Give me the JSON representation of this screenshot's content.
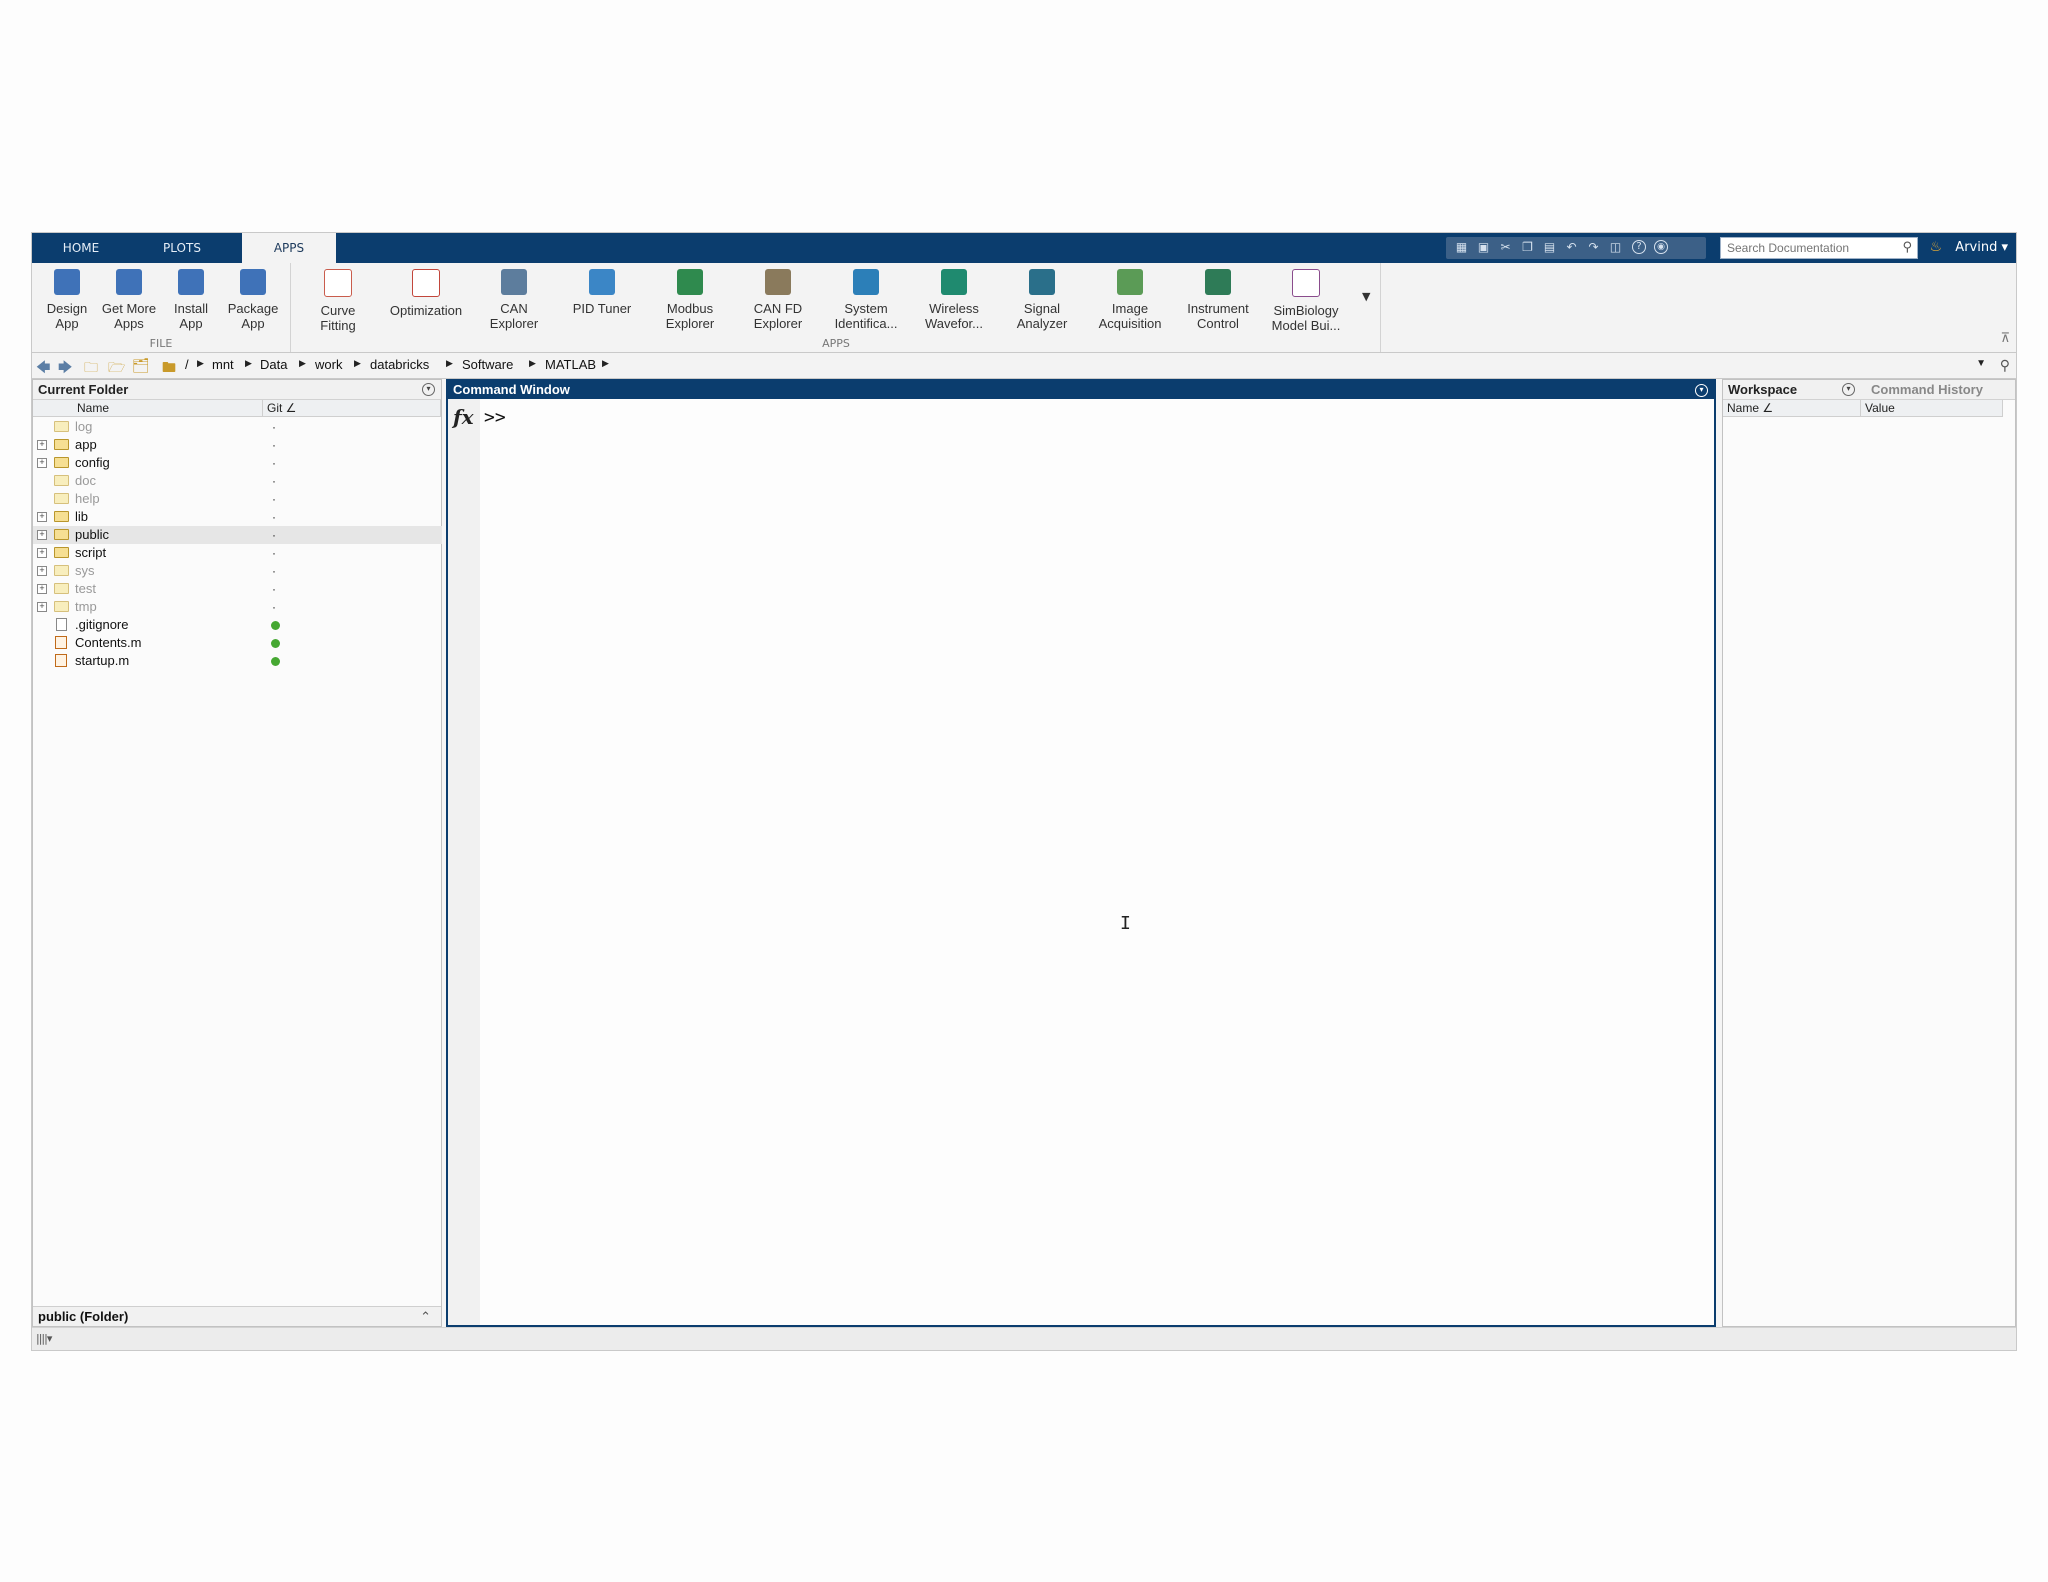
{
  "tabs": [
    {
      "label": "HOME",
      "active": false
    },
    {
      "label": "PLOTS",
      "active": false
    },
    {
      "label": "APPS",
      "active": true
    }
  ],
  "search": {
    "placeholder": "Search Documentation"
  },
  "user": {
    "name": "Arvind ▾"
  },
  "ribbon": {
    "file_section": {
      "label": "FILE",
      "buttons": [
        {
          "line1": "Design",
          "line2": "App",
          "icon": "design-app-icon",
          "color": "#3f72b8"
        },
        {
          "line1": "Get More",
          "line2": "Apps",
          "icon": "get-more-apps-icon",
          "color": "#3f72b8"
        },
        {
          "line1": "Install",
          "line2": "App",
          "icon": "install-app-icon",
          "color": "#3f72b8"
        },
        {
          "line1": "Package",
          "line2": "App",
          "icon": "package-app-icon",
          "color": "#3f72b8"
        }
      ]
    },
    "apps_section": {
      "label": "APPS",
      "buttons": [
        {
          "line1": "Curve",
          "line2": "Fitting",
          "icon": "curve-fitting-icon",
          "color": "#c95c4c"
        },
        {
          "line1": "Optimization",
          "line2": "",
          "icon": "optimization-icon",
          "color": "#c2463b"
        },
        {
          "line1": "CAN",
          "line2": "Explorer",
          "icon": "can-explorer-icon",
          "color": "#5d7d9d"
        },
        {
          "line1": "PID Tuner",
          "line2": "",
          "icon": "pid-tuner-icon",
          "color": "#3b86c6"
        },
        {
          "line1": "Modbus",
          "line2": "Explorer",
          "icon": "modbus-explorer-icon",
          "color": "#2f8a4e"
        },
        {
          "line1": "CAN FD",
          "line2": "Explorer",
          "icon": "can-fd-explorer-icon",
          "color": "#8a7a5c"
        },
        {
          "line1": "System",
          "line2": "Identifica...",
          "icon": "system-identification-icon",
          "color": "#2c7fb8"
        },
        {
          "line1": "Wireless",
          "line2": "Wavefor...",
          "icon": "wireless-waveform-icon",
          "color": "#1f8a6f"
        },
        {
          "line1": "Signal",
          "line2": "Analyzer",
          "icon": "signal-analyzer-icon",
          "color": "#2a6f8a"
        },
        {
          "line1": "Image",
          "line2": "Acquisition",
          "icon": "image-acquisition-icon",
          "color": "#5b9b56"
        },
        {
          "line1": "Instrument",
          "line2": "Control",
          "icon": "instrument-control-icon",
          "color": "#2e7b57"
        },
        {
          "line1": "SimBiology",
          "line2": "Model Bui...",
          "icon": "simbiology-icon",
          "color": "#8a4c8c"
        }
      ]
    }
  },
  "address": {
    "root": "/",
    "crumbs": [
      "mnt",
      "Data",
      "work",
      "databricks",
      "Software",
      "MATLAB"
    ]
  },
  "current_folder": {
    "title": "Current Folder",
    "columns": {
      "name": "Name",
      "git": "Git ∠"
    },
    "rows": [
      {
        "name": "log",
        "type": "folder",
        "expandable": false,
        "dim": true,
        "git": "·"
      },
      {
        "name": "app",
        "type": "folder",
        "expandable": true,
        "dim": false,
        "git": "·"
      },
      {
        "name": "config",
        "type": "folder",
        "expandable": true,
        "dim": false,
        "git": "·"
      },
      {
        "name": "doc",
        "type": "folder",
        "expandable": false,
        "dim": true,
        "git": "·"
      },
      {
        "name": "help",
        "type": "folder",
        "expandable": false,
        "dim": true,
        "git": "·"
      },
      {
        "name": "lib",
        "type": "folder",
        "expandable": true,
        "dim": false,
        "git": "·"
      },
      {
        "name": "public",
        "type": "folder",
        "expandable": true,
        "dim": false,
        "git": "·",
        "selected": true
      },
      {
        "name": "script",
        "type": "folder",
        "expandable": true,
        "dim": false,
        "git": "·"
      },
      {
        "name": "sys",
        "type": "folder",
        "expandable": true,
        "dim": true,
        "git": "·"
      },
      {
        "name": "test",
        "type": "folder",
        "expandable": true,
        "dim": true,
        "git": "·"
      },
      {
        "name": "tmp",
        "type": "folder",
        "expandable": true,
        "dim": true,
        "git": "·"
      },
      {
        "name": ".gitignore",
        "type": "file",
        "expandable": false,
        "dim": false,
        "git": "dot"
      },
      {
        "name": "Contents.m",
        "type": "mfile",
        "expandable": false,
        "dim": false,
        "git": "dot"
      },
      {
        "name": "startup.m",
        "type": "mfile",
        "expandable": false,
        "dim": false,
        "git": "dot"
      }
    ],
    "details": "public  (Folder)"
  },
  "command_window": {
    "title": "Command Window",
    "fx": "fx",
    "prompt": ">>",
    "cursor": "I"
  },
  "workspace": {
    "title": "Workspace",
    "other_tab": "Command History",
    "columns": {
      "name": "Name ∠",
      "value": "Value"
    }
  },
  "colors": {
    "titlebar": "#0b3d6e",
    "git_clean": "#46a832",
    "folder": "#f6df93"
  }
}
